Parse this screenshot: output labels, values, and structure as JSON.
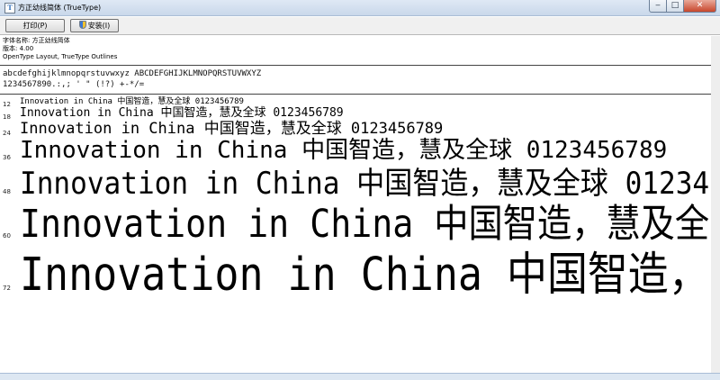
{
  "window": {
    "icon": "font-file-icon",
    "title": "方正幼线简体 (TrueType)",
    "minimize": "‒",
    "maximize": "□",
    "close": "✕"
  },
  "toolbar": {
    "print_label": "打印(P)",
    "install_label": "安装(I)"
  },
  "info": {
    "font_name": "字体名称: 方正幼线简体",
    "version": "版本: 4.00",
    "outlines": "OpenType Layout, TrueType Outlines"
  },
  "charset": {
    "line1": "abcdefghijklmnopqrstuvwxyz ABCDEFGHIJKLMNOPQRSTUVWXYZ",
    "line2": "1234567890.:,; ' \" (!?) +-*/="
  },
  "samples": [
    {
      "size": "12",
      "text": "Innovation in China 中国智造，慧及全球 0123456789"
    },
    {
      "size": "18",
      "text": "Innovation in China 中国智造，慧及全球 0123456789"
    },
    {
      "size": "24",
      "text": "Innovation in China 中国智造，慧及全球 0123456789"
    },
    {
      "size": "36",
      "text": "Innovation in China 中国智造，慧及全球 0123456789"
    },
    {
      "size": "48",
      "text": "Innovation in China 中国智造，慧及全球 01234"
    },
    {
      "size": "60",
      "text": "Innovation in China 中国智造，慧及全"
    },
    {
      "size": "72",
      "text": "Innovation in China 中国智造，"
    }
  ]
}
